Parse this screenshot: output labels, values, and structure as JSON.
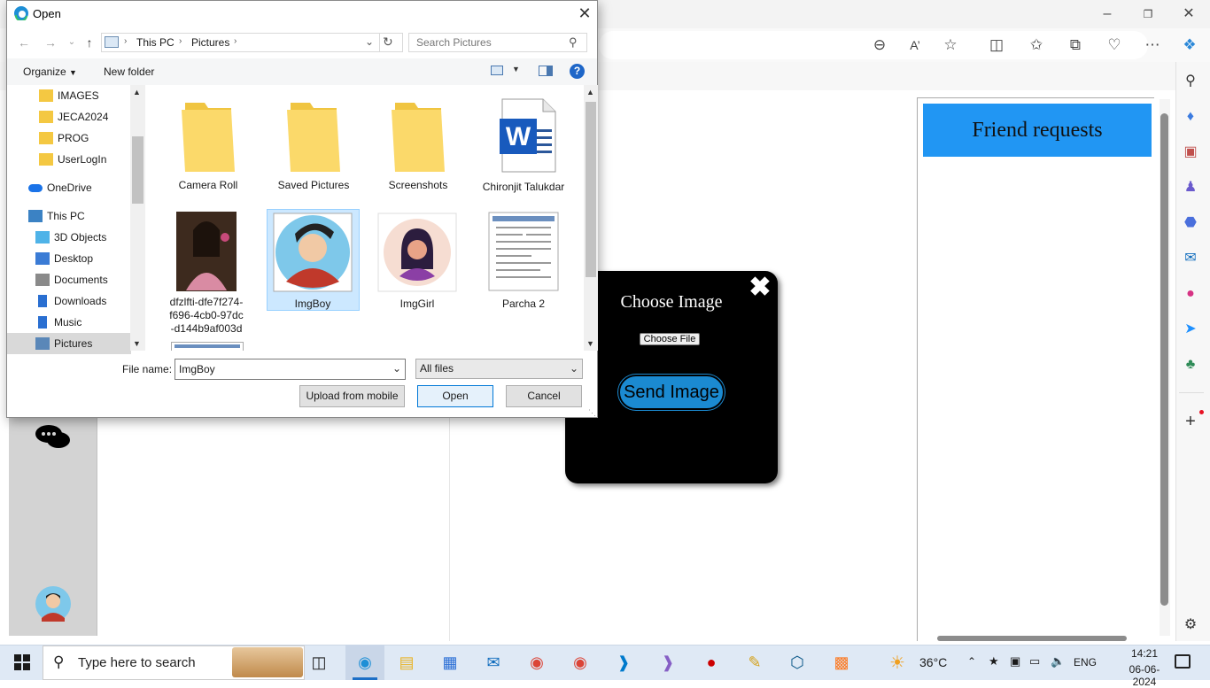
{
  "browser": {
    "url_placeholder": "",
    "friend_panel_title": "Friend requests"
  },
  "modal": {
    "title": "Choose Image",
    "choose_file_label": "Choose File",
    "send_button_label": "Send Image",
    "close_glyph": "✖"
  },
  "dialog": {
    "title": "Open",
    "breadcrumb": [
      "This PC",
      "Pictures"
    ],
    "search_placeholder": "Search Pictures",
    "organize_label": "Organize",
    "new_folder_label": "New folder",
    "nav_items": [
      {
        "label": "IMAGES",
        "icon": "folder-icon"
      },
      {
        "label": "JECA2024",
        "icon": "folder-icon"
      },
      {
        "label": "PROG",
        "icon": "folder-icon"
      },
      {
        "label": "UserLogIn",
        "icon": "folder-icon"
      },
      {
        "label": "OneDrive",
        "icon": "cloud-icon"
      },
      {
        "label": "This PC",
        "icon": "computer-icon"
      },
      {
        "label": "3D Objects",
        "icon": "cube-icon"
      },
      {
        "label": "Desktop",
        "icon": "desktop-icon"
      },
      {
        "label": "Documents",
        "icon": "document-icon"
      },
      {
        "label": "Downloads",
        "icon": "download-icon"
      },
      {
        "label": "Music",
        "icon": "music-icon"
      },
      {
        "label": "Pictures",
        "icon": "pictures-icon"
      }
    ],
    "files": [
      {
        "name": "Camera Roll",
        "type": "folder"
      },
      {
        "name": "Saved Pictures",
        "type": "folder"
      },
      {
        "name": "Screenshots",
        "type": "folder"
      },
      {
        "name": "Chironjit Talukdar",
        "type": "word"
      },
      {
        "name": "dfzlfti-dfe7f274-f696-4cb0-97dc-d144b9af003d",
        "type": "photo"
      },
      {
        "name": "ImgBoy",
        "type": "avatar-boy"
      },
      {
        "name": "ImgGirl",
        "type": "avatar-girl"
      },
      {
        "name": "Parcha 2",
        "type": "document"
      }
    ],
    "filename_label": "File name:",
    "filename_value": "ImgBoy",
    "filter_value": "All files",
    "upload_mobile_label": "Upload from mobile",
    "open_label": "Open",
    "cancel_label": "Cancel"
  },
  "taskbar": {
    "search_placeholder": "Type here to search",
    "temperature": "36°C",
    "language": "ENG",
    "time": "14:21",
    "date": "06-06-2024"
  },
  "colors": {
    "friend_header": "#2196f3",
    "send_button": "#1b8ad1",
    "selected_tile": "#cce8ff"
  }
}
